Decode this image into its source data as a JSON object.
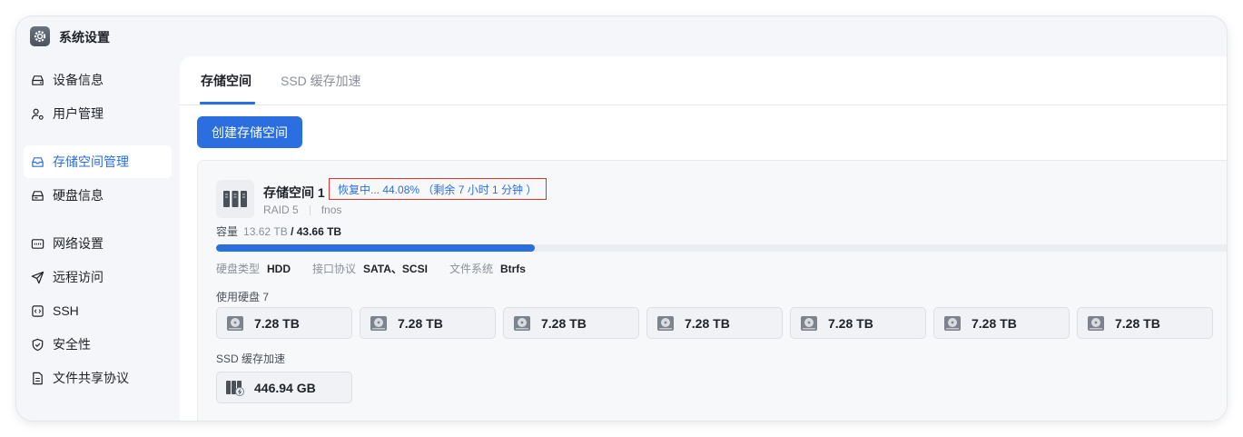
{
  "window": {
    "title": "系统设置",
    "icon": "gear-icon"
  },
  "sidebar": {
    "items": [
      {
        "label": "设备信息",
        "icon": "device-icon",
        "active": false
      },
      {
        "label": "用户管理",
        "icon": "users-icon",
        "active": false
      },
      {
        "label": "存储空间管理",
        "icon": "storage-icon",
        "active": true
      },
      {
        "label": "硬盘信息",
        "icon": "harddisk-icon",
        "active": false
      },
      {
        "label": "网络设置",
        "icon": "network-icon",
        "active": false
      },
      {
        "label": "远程访问",
        "icon": "send-icon",
        "active": false
      },
      {
        "label": "SSH",
        "icon": "terminal-icon",
        "active": false
      },
      {
        "label": "安全性",
        "icon": "shield-icon",
        "active": false
      },
      {
        "label": "文件共享协议",
        "icon": "document-icon",
        "active": false
      }
    ]
  },
  "tabs": [
    {
      "label": "存储空间",
      "active": true
    },
    {
      "label": "SSD 缓存加速",
      "active": false
    }
  ],
  "actions": {
    "create_label": "创建存储空间"
  },
  "pool": {
    "name": "存储空间 1",
    "status": "恢复中... 44.08% （剩余 7 小时 1 分钟 ）",
    "raid": "RAID 5",
    "filesystem_label": "fnos",
    "capacity_label": "容量",
    "used": "13.62 TB",
    "total": "/ 43.66 TB",
    "usage_fraction": 0.312,
    "props": {
      "disk_type_label": "硬盘类型",
      "disk_type": "HDD",
      "interface_label": "接口协议",
      "interface": "SATA、SCSI",
      "fs_label": "文件系统",
      "fs": "Btrfs"
    },
    "disks_label": "使用硬盘 7",
    "disks": [
      "7.28 TB",
      "7.28 TB",
      "7.28 TB",
      "7.28 TB",
      "7.28 TB",
      "7.28 TB",
      "7.28 TB"
    ],
    "ssd_label": "SSD 缓存加速",
    "ssd_size": "446.94 GB"
  },
  "colors": {
    "accent": "#2a6ee0",
    "status_border": "#e0332c"
  }
}
